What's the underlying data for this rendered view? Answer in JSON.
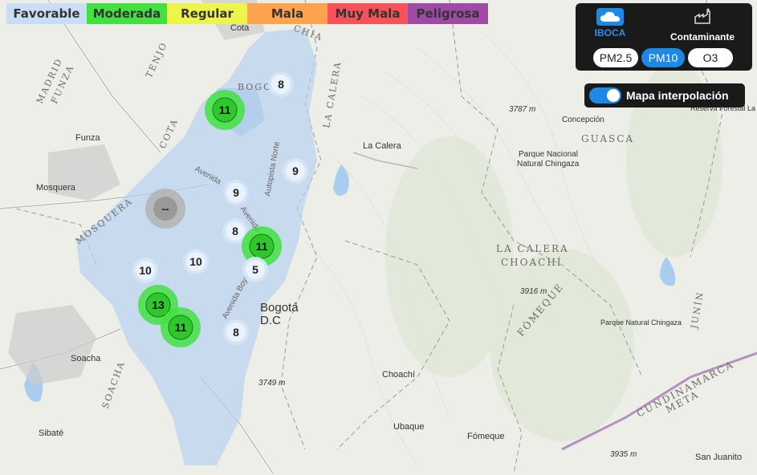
{
  "legend": [
    {
      "label": "Favorable",
      "color": "#c9def5"
    },
    {
      "label": "Moderada",
      "color": "#43e041"
    },
    {
      "label": "Regular",
      "color": "#eef54a"
    },
    {
      "label": "Mala",
      "color": "#fda34e"
    },
    {
      "label": "Muy Mala",
      "color": "#f65257"
    },
    {
      "label": "Peligrosa",
      "color": "#a04aa8"
    }
  ],
  "panel": {
    "logo_label": "IBOCA",
    "contaminant_label": "Contaminante",
    "pollutants": [
      "PM2.5",
      "PM10",
      "O3"
    ],
    "selected_pollutant": "PM10"
  },
  "interpolation": {
    "label": "Mapa interpolación",
    "enabled": true
  },
  "stations": [
    {
      "value": "8",
      "level": "favorable"
    },
    {
      "value": "11",
      "level": "moderada"
    },
    {
      "value": "9",
      "level": "favorable"
    },
    {
      "value": "9",
      "level": "favorable"
    },
    {
      "value": "--",
      "level": "none"
    },
    {
      "value": "8",
      "level": "favorable"
    },
    {
      "value": "11",
      "level": "moderada"
    },
    {
      "value": "10",
      "level": "favorable"
    },
    {
      "value": "10",
      "level": "favorable"
    },
    {
      "value": "5",
      "level": "favorable"
    },
    {
      "value": "13",
      "level": "moderada"
    },
    {
      "value": "11",
      "level": "moderada"
    },
    {
      "value": "8",
      "level": "favorable"
    }
  ],
  "place_labels": [
    "Cota",
    "Funza",
    "Mosquera",
    "Soacha",
    "Sibaté",
    "La Calera",
    "Bogotá",
    "D.C",
    "Choachí",
    "Ubaque",
    "Fómeque",
    "San Juanito",
    "Concepción",
    "Parque Nacional",
    "Natural Chingaza",
    "Reserva Forestal La Bolsa",
    "Parque Natural Chingaza",
    "3787 m",
    "3916 m",
    "3749 m",
    "3935 m"
  ],
  "region_labels": [
    "GUASCA",
    "LA CALERA",
    "CHOACHÍ",
    "FÓMEQUE",
    "CUNDINAMARCA",
    "META",
    "MOSQUERA",
    "SOACHA",
    "MADRID",
    "FUNZA",
    "TENJO",
    "COTA",
    "LA CALERA",
    "CHÍA",
    "JUNÍN",
    "BOGOTÁ"
  ],
  "street_labels": [
    "Avenida",
    "Autopista Norte",
    "Avenida Boyacá",
    "Avenida"
  ]
}
